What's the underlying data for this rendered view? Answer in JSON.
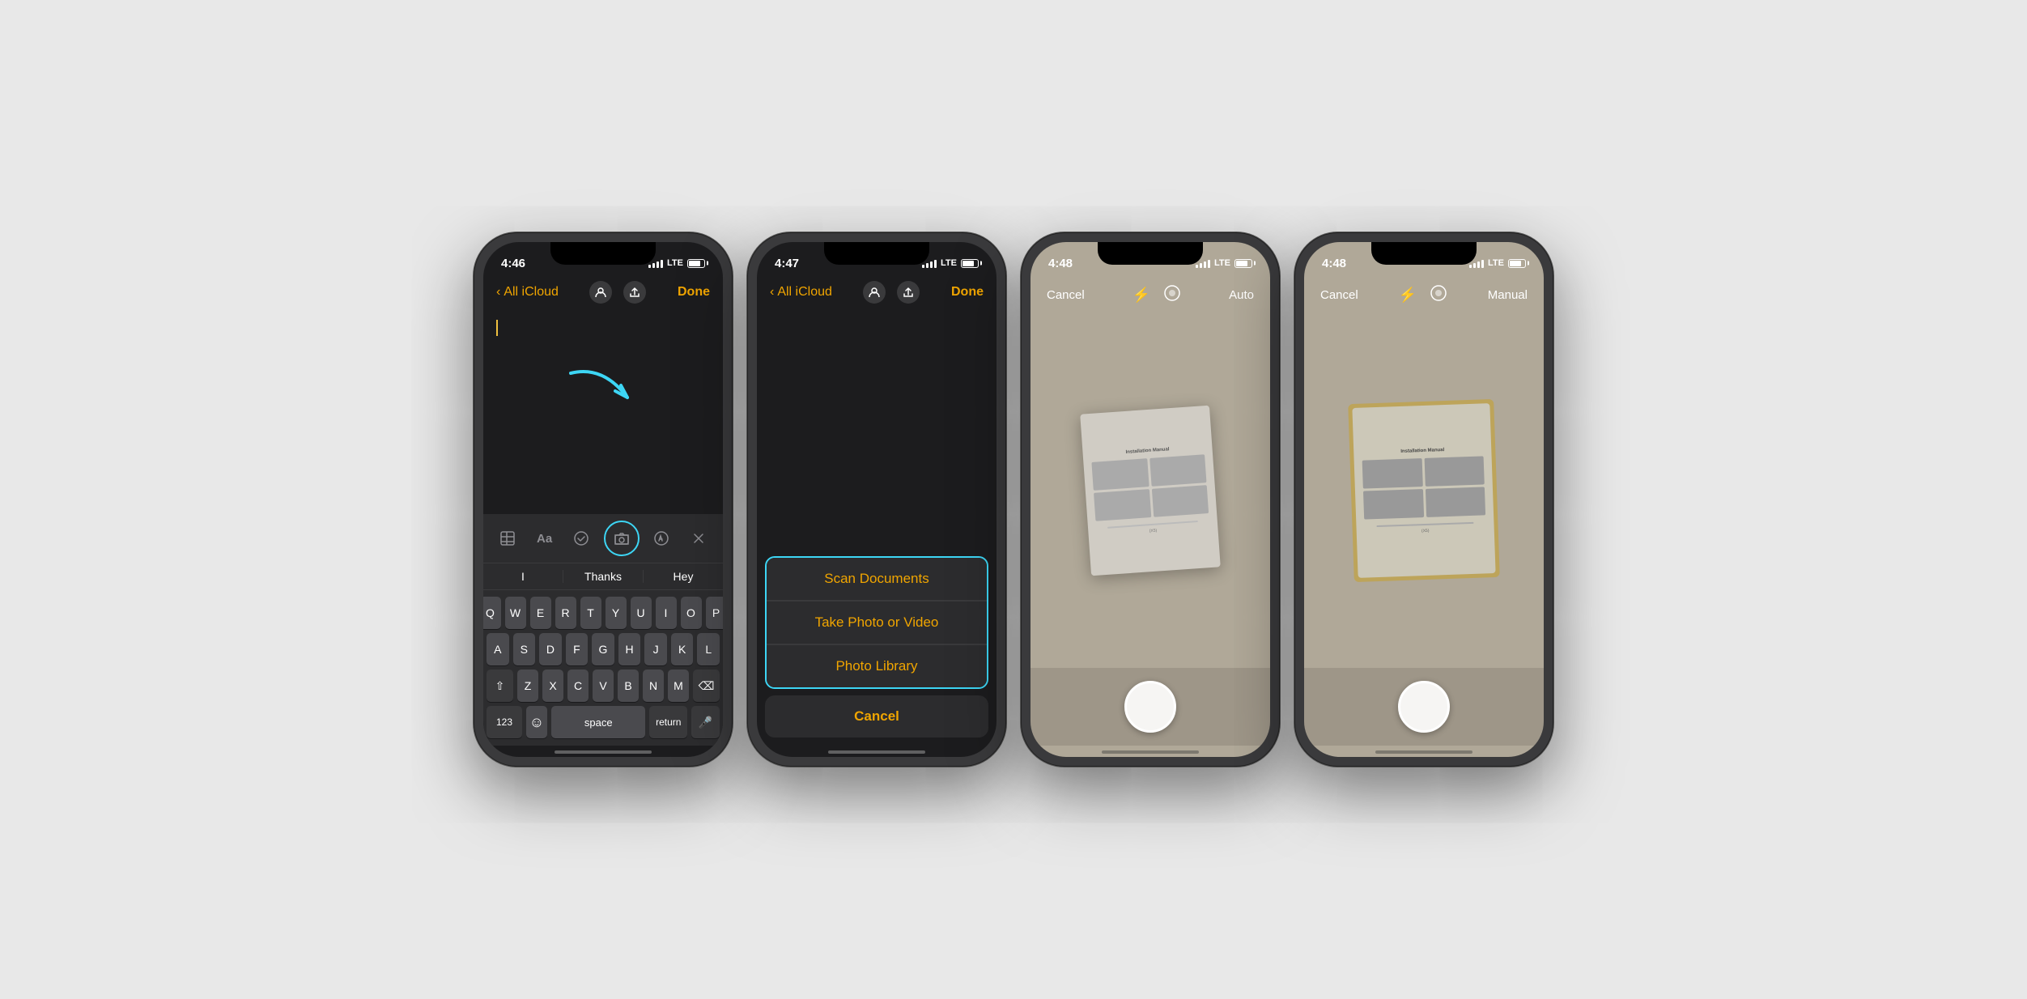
{
  "phones": [
    {
      "id": "phone1",
      "time": "4:46",
      "nav": {
        "back": "All iCloud",
        "done": "Done"
      },
      "toolbar_icons": [
        "grid-icon",
        "format-icon",
        "check-icon",
        "camera-icon",
        "markup-icon",
        "close-icon"
      ],
      "predictive": [
        "I",
        "Thanks",
        "Hey"
      ],
      "keyboard_rows": [
        [
          "Q",
          "W",
          "E",
          "R",
          "T",
          "Y",
          "U",
          "I",
          "O",
          "P"
        ],
        [
          "A",
          "S",
          "D",
          "F",
          "G",
          "H",
          "J",
          "K",
          "L"
        ],
        [
          "⇧",
          "Z",
          "X",
          "C",
          "V",
          "B",
          "N",
          "M",
          "⌫"
        ],
        [
          "123",
          "space",
          "return"
        ]
      ]
    },
    {
      "id": "phone2",
      "time": "4:47",
      "nav": {
        "back": "All iCloud",
        "done": "Done"
      },
      "menu_items": [
        {
          "label": "Scan Documents",
          "highlighted": true
        },
        {
          "label": "Take Photo or Video",
          "highlighted": false
        },
        {
          "label": "Photo Library",
          "highlighted": false
        }
      ],
      "cancel_label": "Cancel"
    },
    {
      "id": "phone3",
      "time": "4:48",
      "camera": {
        "cancel": "Cancel",
        "mode": "Auto",
        "flash": "⚡",
        "lens": "●"
      }
    },
    {
      "id": "phone4",
      "time": "4:48",
      "camera": {
        "cancel": "Cancel",
        "mode": "Manual",
        "flash": "⚡",
        "lens": "●"
      }
    }
  ],
  "colors": {
    "accent_gold": "#f0a500",
    "highlight_blue": "#3dd6f5",
    "dark_bg": "#1c1c1e",
    "camera_bg": "#b0a898"
  }
}
